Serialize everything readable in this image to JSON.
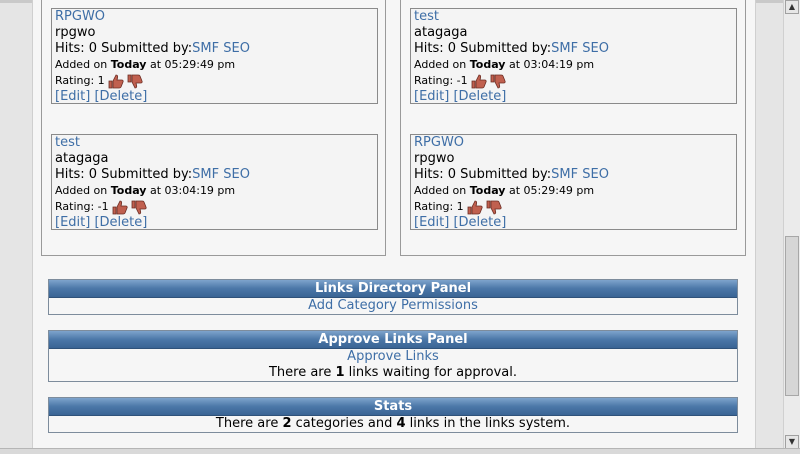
{
  "cards_left": [
    {
      "title": "RPGWO",
      "description": "rpgwo",
      "hits_label": "Hits: 0 Submitted by:",
      "submitter": "SMF SEO",
      "added_prefix": "Added on ",
      "added_day": "Today",
      "added_time": " at 05:29:49 pm",
      "rating_label": "Rating: 1",
      "edit": "[Edit]",
      "delete": "[Delete]"
    },
    {
      "title": "test",
      "description": "atagaga",
      "hits_label": "Hits: 0 Submitted by:",
      "submitter": "SMF SEO",
      "added_prefix": "Added on ",
      "added_day": "Today",
      "added_time": " at 03:04:19 pm",
      "rating_label": "Rating: -1",
      "edit": "[Edit]",
      "delete": "[Delete]"
    }
  ],
  "cards_right": [
    {
      "title": "test",
      "description": "atagaga",
      "hits_label": "Hits: 0 Submitted by:",
      "submitter": "SMF SEO",
      "added_prefix": "Added on ",
      "added_day": "Today",
      "added_time": " at 03:04:19 pm",
      "rating_label": "Rating: -1",
      "edit": "[Edit]",
      "delete": "[Delete]"
    },
    {
      "title": "RPGWO",
      "description": "rpgwo",
      "hits_label": "Hits: 0 Submitted by:",
      "submitter": "SMF SEO",
      "added_prefix": "Added on ",
      "added_day": "Today",
      "added_time": " at 05:29:49 pm",
      "rating_label": "Rating: 1",
      "edit": "[Edit]",
      "delete": "[Delete]"
    }
  ],
  "links_directory_panel": {
    "title": "Links Directory Panel",
    "link": "Add Category Permissions"
  },
  "approve_links_panel": {
    "title": "Approve Links Panel",
    "link": "Approve Links",
    "text_before": "There are ",
    "count": "1",
    "text_after": " links waiting for approval."
  },
  "stats_panel": {
    "title": "Stats",
    "text_1": "There are ",
    "categories": "2",
    "text_2": " categories and ",
    "links": "4",
    "text_3": " links in the links system."
  },
  "icons": {
    "thumb_up": "thumbs-up-icon",
    "thumb_down": "thumbs-down-icon"
  },
  "colors": {
    "link": "#3e6ea6",
    "panel_header": "#4b77a8"
  }
}
